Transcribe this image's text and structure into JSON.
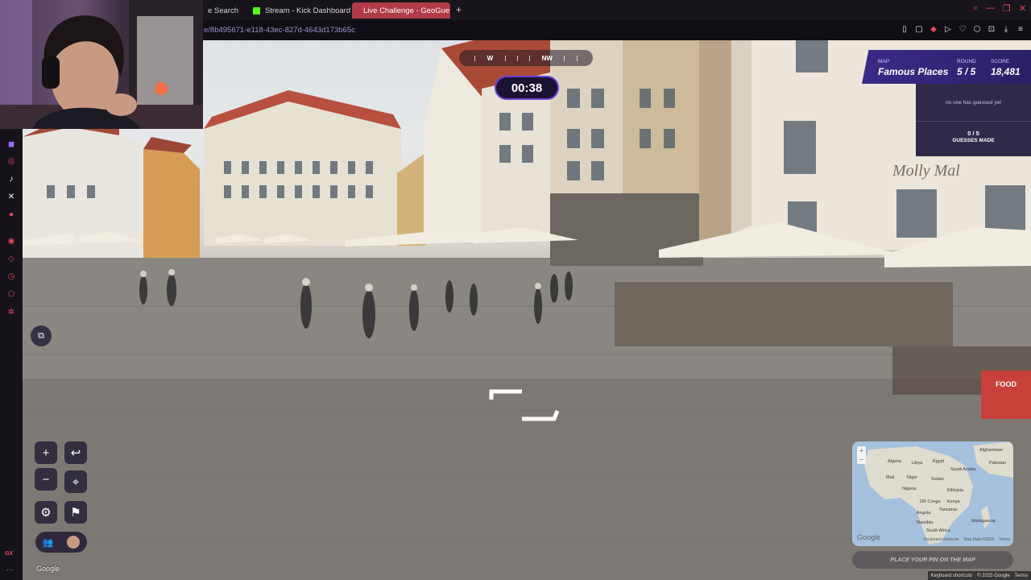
{
  "browser": {
    "tabs": [
      {
        "label": "e Search",
        "active": false
      },
      {
        "label": "Stream - Kick Dashboard",
        "active": false
      },
      {
        "label": "Live Challenge - GeoGue",
        "active": true
      }
    ],
    "new_tab": "+",
    "url": "e/8b495671-e118-43ec-827d-4643d173b65c"
  },
  "game": {
    "compass": {
      "w": "W",
      "nw": "NW"
    },
    "timer": "00:38",
    "status": {
      "map_label": "MAP",
      "map_value": "Famous Places",
      "round_label": "ROUND",
      "round_value": "5 / 5",
      "score_label": "SCORE",
      "score_value": "18,481"
    },
    "guesses": {
      "none_text": "no one has guessed yet",
      "count": "0 / 5",
      "label": "GUESSES MADE"
    },
    "controls": {
      "zoom_in": "+",
      "zoom_out": "−",
      "undo": "↩",
      "checkpoint": "⌖",
      "settings": "⚙",
      "flag": "⚑"
    },
    "place_pin": "PLACE YOUR PIN ON THE MAP"
  },
  "minimap": {
    "labels": {
      "afghanistan": "Afghanistan",
      "algeria": "Algeria",
      "libya": "Libya",
      "egypt": "Egypt",
      "saudi": "Saudi Arabia",
      "pakistan": "Pakistan",
      "mali": "Mali",
      "niger": "Niger",
      "sudan": "Sudan",
      "nigeria": "Nigeria",
      "ethiopia": "Ethiopia",
      "drc": "DR Congo",
      "kenya": "Kenya",
      "tanzania": "Tanzania",
      "angola": "Angola",
      "namibia": "Namibia",
      "madagascar": "Madagascar",
      "south_africa": "South Africa"
    },
    "google": "Google",
    "keyboard": "Keyboard shortcuts",
    "map_data": "Map Data ©2025",
    "terms": "Terms"
  },
  "footer": {
    "google": "Google",
    "keyboard": "Keyboard shortcuts",
    "map_data": "© 2025 Google",
    "terms": "Terms"
  },
  "scene": {
    "sign_text": "Molly Mal",
    "food_sign": "FOOD"
  }
}
